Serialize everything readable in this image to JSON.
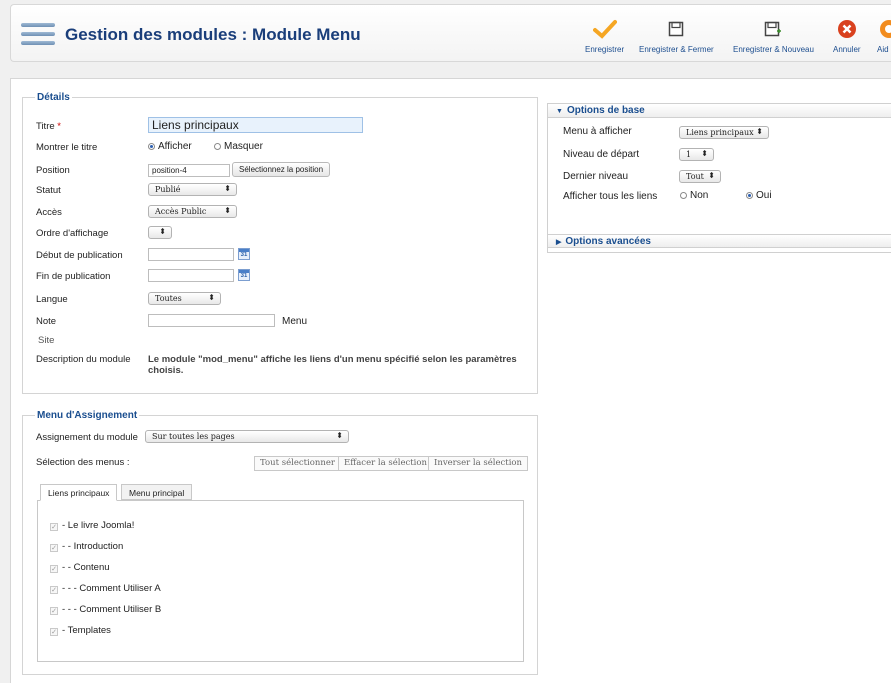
{
  "header": {
    "title": "Gestion des modules : Module Menu",
    "toolbar": {
      "save": "Enregistrer",
      "save_close": "Enregistrer & Fermer",
      "save_new": "Enregistrer & Nouveau",
      "cancel": "Annuler",
      "help": "Aid"
    }
  },
  "details": {
    "legend": "Détails",
    "title_label": "Titre",
    "required_mark": "*",
    "title_value": "Liens principaux",
    "show_title_label": "Montrer le titre",
    "show_option": "Afficher",
    "hide_option": "Masquer",
    "position_label": "Position",
    "position_value": "position-4",
    "select_position_button": "Sélectionnez la position",
    "status_label": "Statut",
    "status_value": "Publié",
    "access_label": "Accès",
    "access_value": "Accès Public",
    "order_label": "Ordre d'affichage",
    "order_value": "",
    "publish_start_label": "Début de publication",
    "publish_end_label": "Fin de publication",
    "calendar_glyph": "31",
    "language_label": "Langue",
    "language_value": "Toutes",
    "note_label": "Note",
    "note_suffix": "Menu",
    "site_label": "Site",
    "description_label": "Description du module",
    "description_text": "Le module \"mod_menu\" affiche les liens d'un menu spécifié selon les paramètres choisis."
  },
  "assignment": {
    "legend": "Menu d'Assignement",
    "module_assignment_label": "Assignement du module",
    "module_assignment_value": "Sur toutes les pages",
    "menu_selection_label": "Sélection des menus :",
    "select_all": "Tout sélectionner",
    "clear_selection": "Effacer la sélection",
    "invert_selection": "Inverser la sélection",
    "tabs": [
      "Liens principaux",
      "Menu principal"
    ],
    "items": [
      "- Le livre Joomla!",
      "- - Introduction",
      "- - Contenu",
      "- - - Comment Utiliser A",
      "- - - Comment Utiliser B",
      "- Templates"
    ]
  },
  "basic_options": {
    "heading": "Options de base",
    "menu_label": "Menu à afficher",
    "menu_value": "Liens principaux",
    "start_level_label": "Niveau de départ",
    "start_level_value": "1",
    "end_level_label": "Dernier niveau",
    "end_level_value": "Tout",
    "show_all_label": "Afficher tous les liens",
    "no_option": "Non",
    "yes_option": "Oui"
  },
  "advanced_options": {
    "heading": "Options avancées"
  },
  "colors": {
    "title_blue": "#1a3e7a",
    "link_blue": "#1a4e8f",
    "save_orange": "#f5a623",
    "cancel_red": "#d9411e"
  }
}
